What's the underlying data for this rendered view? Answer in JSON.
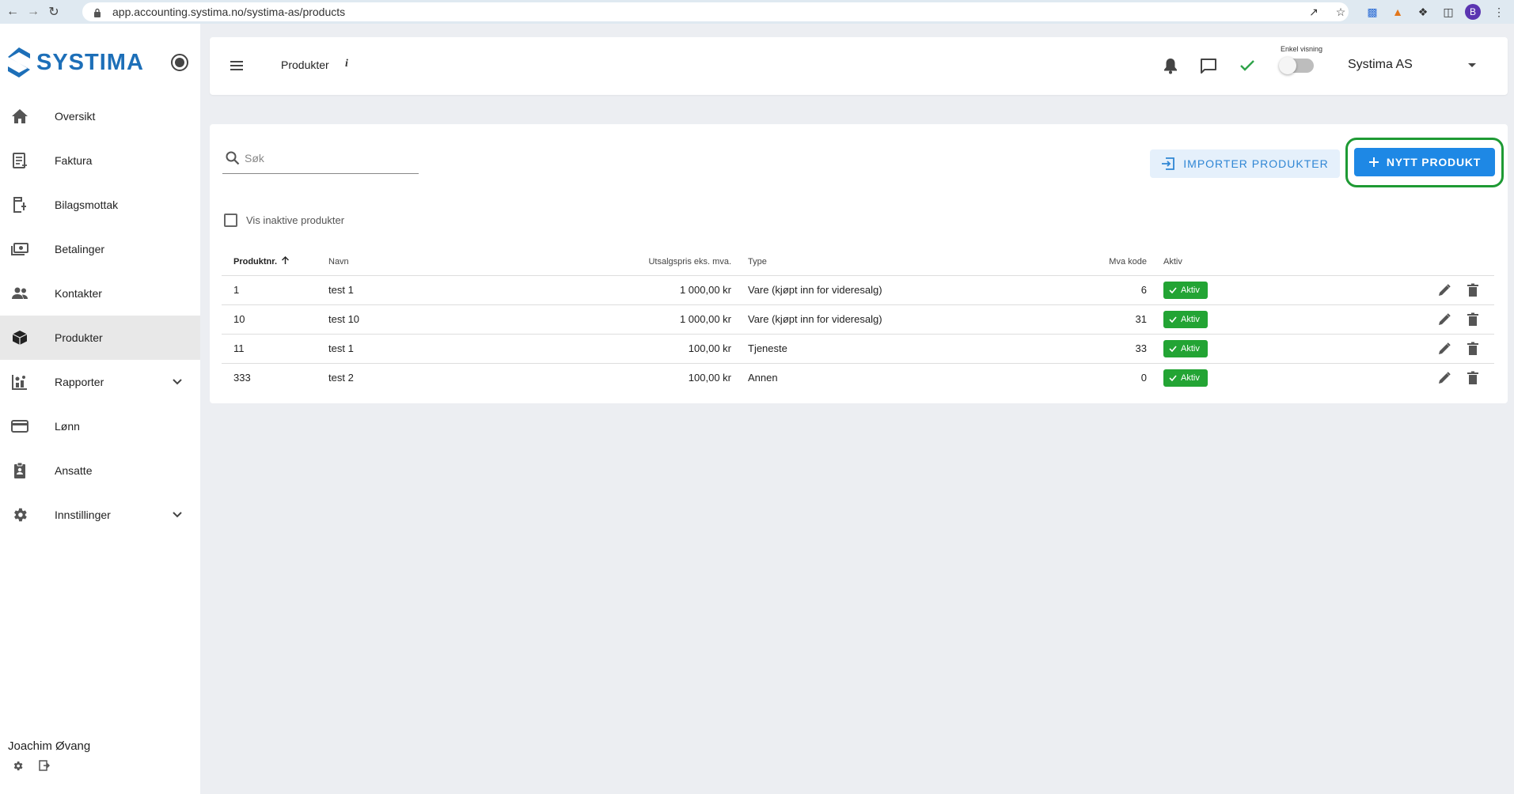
{
  "browser": {
    "url": "app.accounting.systima.no/systima-as/products",
    "profile_initial": "B"
  },
  "sidebar": {
    "logo_text": "SYSTIMA",
    "items": [
      {
        "label": "Oversikt",
        "icon": "home-icon"
      },
      {
        "label": "Faktura",
        "icon": "invoice-icon"
      },
      {
        "label": "Bilagsmottak",
        "icon": "receipt-inbox-icon"
      },
      {
        "label": "Betalinger",
        "icon": "payments-icon"
      },
      {
        "label": "Kontakter",
        "icon": "contacts-icon"
      },
      {
        "label": "Produkter",
        "icon": "box-icon",
        "active": true
      },
      {
        "label": "Rapporter",
        "icon": "reports-icon",
        "expandable": true
      },
      {
        "label": "Lønn",
        "icon": "card-icon"
      },
      {
        "label": "Ansatte",
        "icon": "badge-icon"
      },
      {
        "label": "Innstillinger",
        "icon": "gear-icon",
        "expandable": true
      }
    ],
    "user_name": "Joachim Øvang"
  },
  "header": {
    "title": "Produkter",
    "info": "i",
    "simple_view_label": "Enkel visning",
    "company": "Systima AS"
  },
  "toolbar": {
    "search_placeholder": "Søk",
    "import_label": "IMPORTER PRODUKTER",
    "new_label": "NYTT PRODUKT",
    "show_inactive_label": "Vis inaktive produkter"
  },
  "table": {
    "columns": [
      "Produktnr.",
      "Navn",
      "Utsalgspris eks. mva.",
      "Type",
      "Mva kode",
      "Aktiv"
    ],
    "rows": [
      {
        "nr": "1",
        "name": "test 1",
        "price": "1 000,00 kr",
        "type": "Vare (kjøpt inn for videresalg)",
        "vat": "6",
        "status": "Aktiv"
      },
      {
        "nr": "10",
        "name": "test 10",
        "price": "1 000,00 kr",
        "type": "Vare (kjøpt inn for videresalg)",
        "vat": "31",
        "status": "Aktiv"
      },
      {
        "nr": "11",
        "name": "test 1",
        "price": "100,00 kr",
        "type": "Tjeneste",
        "vat": "33",
        "status": "Aktiv"
      },
      {
        "nr": "333",
        "name": "test 2",
        "price": "100,00 kr",
        "type": "Annen",
        "vat": "0",
        "status": "Aktiv"
      }
    ]
  },
  "colors": {
    "brand": "#1d6fb8",
    "primary_button": "#1e88e5",
    "active_badge": "#23a434",
    "highlight": "#1e9a34"
  }
}
